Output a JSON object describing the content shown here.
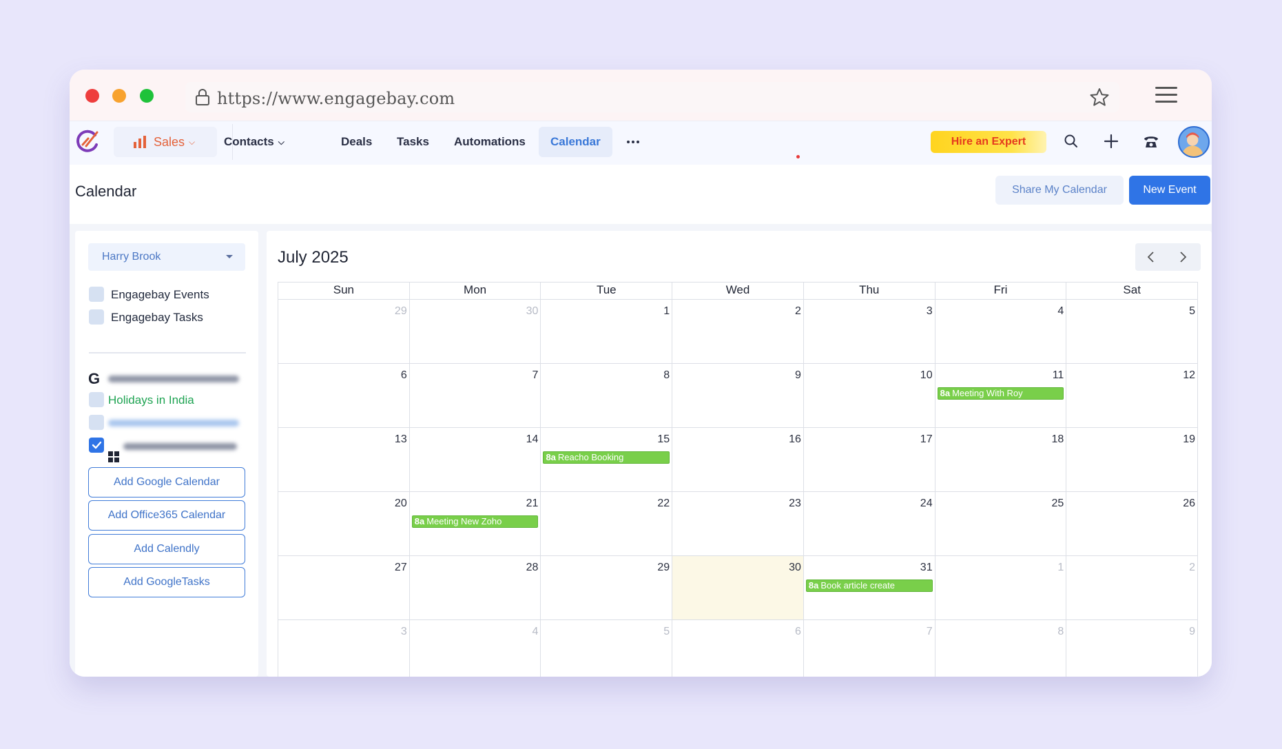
{
  "browser": {
    "url": "https://www.engagebay.com"
  },
  "nav": {
    "sales_label": "Sales",
    "items": [
      "Contacts",
      "Deals",
      "Tasks",
      "Automations",
      "Calendar"
    ],
    "active": "Calendar",
    "hire_label": "Hire an Expert"
  },
  "header": {
    "title": "Calendar",
    "share_label": "Share My Calendar",
    "new_event_label": "New Event"
  },
  "sidebar": {
    "user": "Harry Brook",
    "calendars": [
      {
        "label": "Engagebay Events",
        "checked": false
      },
      {
        "label": "Engagebay Tasks",
        "checked": false
      }
    ],
    "holidays_label": "Holidays in India",
    "add_buttons": [
      "Add Google Calendar",
      "Add Office365 Calendar",
      "Add Calendly",
      "Add GoogleTasks"
    ]
  },
  "calendar": {
    "month_title": "July 2025",
    "weekdays": [
      "Sun",
      "Mon",
      "Tue",
      "Wed",
      "Thu",
      "Fri",
      "Sat"
    ],
    "weeks": [
      [
        {
          "d": "29",
          "o": true
        },
        {
          "d": "30",
          "o": true
        },
        {
          "d": "1"
        },
        {
          "d": "2"
        },
        {
          "d": "3"
        },
        {
          "d": "4"
        },
        {
          "d": "5"
        }
      ],
      [
        {
          "d": "6"
        },
        {
          "d": "7"
        },
        {
          "d": "8"
        },
        {
          "d": "9"
        },
        {
          "d": "10"
        },
        {
          "d": "11",
          "ev": {
            "time": "8a",
            "title": "Meeting With Roy"
          }
        },
        {
          "d": "12"
        }
      ],
      [
        {
          "d": "13"
        },
        {
          "d": "14"
        },
        {
          "d": "15",
          "ev": {
            "time": "8a",
            "title": "Reacho Booking"
          }
        },
        {
          "d": "16"
        },
        {
          "d": "17"
        },
        {
          "d": "18"
        },
        {
          "d": "19"
        }
      ],
      [
        {
          "d": "20"
        },
        {
          "d": "21",
          "ev": {
            "time": "8a",
            "title": "Meeting New Zoho"
          }
        },
        {
          "d": "22"
        },
        {
          "d": "23"
        },
        {
          "d": "24"
        },
        {
          "d": "25"
        },
        {
          "d": "26"
        }
      ],
      [
        {
          "d": "27"
        },
        {
          "d": "28"
        },
        {
          "d": "29"
        },
        {
          "d": "30",
          "today": true
        },
        {
          "d": "31",
          "ev": {
            "time": "8a",
            "title": "Book article create"
          }
        },
        {
          "d": "1",
          "o": true
        },
        {
          "d": "2",
          "o": true
        }
      ],
      [
        {
          "d": "3",
          "o": true
        },
        {
          "d": "4",
          "o": true
        },
        {
          "d": "5",
          "o": true
        },
        {
          "d": "6",
          "o": true
        },
        {
          "d": "7",
          "o": true
        },
        {
          "d": "8",
          "o": true
        },
        {
          "d": "9",
          "o": true
        }
      ]
    ]
  },
  "colors": {
    "accent": "#2f74e6",
    "event_green": "#79cf4a",
    "sales_orange": "#e4623a"
  }
}
